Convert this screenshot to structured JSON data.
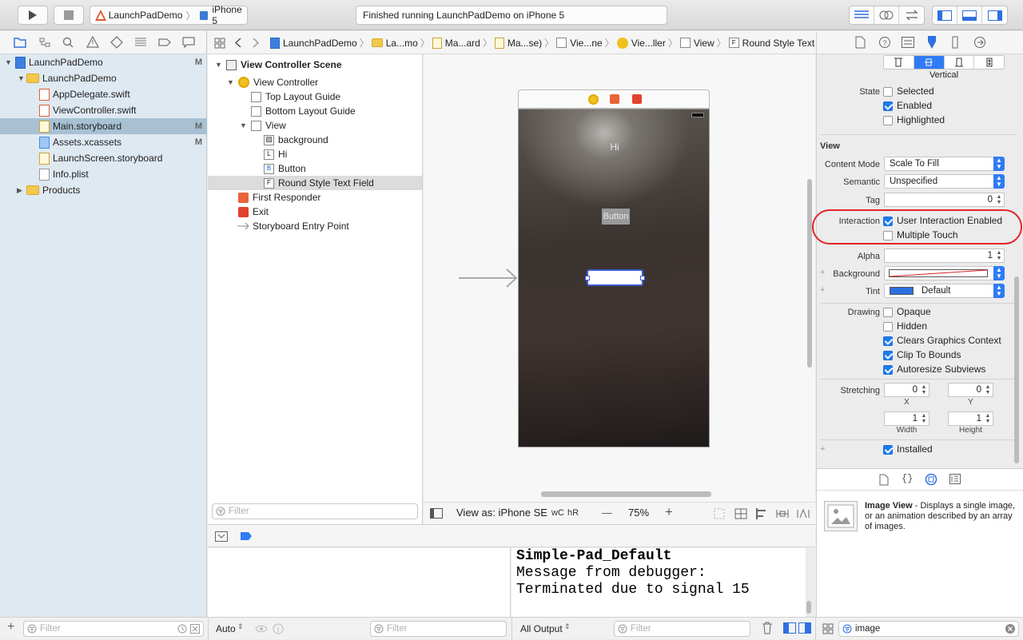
{
  "toolbar": {
    "scheme": "LaunchPadDemo",
    "device": "iPhone 5",
    "activity": "Finished running LaunchPadDemo on iPhone 5"
  },
  "navigator": {
    "items": [
      {
        "label": "LaunchPadDemo",
        "marker": "M"
      },
      {
        "label": "LaunchPadDemo",
        "marker": ""
      },
      {
        "label": "AppDelegate.swift",
        "marker": ""
      },
      {
        "label": "ViewController.swift",
        "marker": ""
      },
      {
        "label": "Main.storyboard",
        "marker": "M"
      },
      {
        "label": "Assets.xcassets",
        "marker": "M"
      },
      {
        "label": "LaunchScreen.storyboard",
        "marker": ""
      },
      {
        "label": "Info.plist",
        "marker": ""
      },
      {
        "label": "Products",
        "marker": ""
      }
    ],
    "filter_placeholder": "Filter"
  },
  "jumpbar": {
    "crumbs": [
      "LaunchPadDemo",
      "La...mo",
      "Ma...ard",
      "Ma...se)",
      "Vie...ne",
      "Vie...ller",
      "View",
      "Round Style Text Field"
    ]
  },
  "outline": {
    "items": [
      {
        "label": "View Controller Scene",
        "icon": "scene-icon"
      },
      {
        "label": "View Controller",
        "icon": "view-controller-icon"
      },
      {
        "label": "Top Layout Guide",
        "icon": "layout-guide-icon"
      },
      {
        "label": "Bottom Layout Guide",
        "icon": "layout-guide-icon"
      },
      {
        "label": "View",
        "icon": "view-icon"
      },
      {
        "label": "background",
        "icon": "image-view-icon"
      },
      {
        "label": "Hi",
        "icon": "label-icon",
        "glyph": "L"
      },
      {
        "label": "Button",
        "icon": "button-icon",
        "glyph": "B"
      },
      {
        "label": "Round Style Text Field",
        "icon": "text-field-icon",
        "glyph": "F"
      },
      {
        "label": "First Responder",
        "icon": "first-responder-icon"
      },
      {
        "label": "Exit",
        "icon": "exit-icon"
      },
      {
        "label": "Storyboard Entry Point",
        "icon": "entry-arrow-icon"
      }
    ],
    "filter_placeholder": "Filter"
  },
  "canvas": {
    "hi_label": "Hi",
    "button_label": "Button",
    "view_as": "View as: iPhone SE",
    "size_class_w": "wC",
    "size_class_h": "hR",
    "zoom_minus": "—",
    "zoom": "75%",
    "zoom_plus": "+"
  },
  "inspector": {
    "control_label": "Vertical",
    "state_label": "State",
    "state": [
      {
        "label": "Selected",
        "checked": false
      },
      {
        "label": "Enabled",
        "checked": true
      },
      {
        "label": "Highlighted",
        "checked": false
      }
    ],
    "view_section": "View",
    "content_mode_label": "Content Mode",
    "content_mode": "Scale To Fill",
    "semantic_label": "Semantic",
    "semantic": "Unspecified",
    "tag_label": "Tag",
    "tag": "0",
    "interaction_label": "Interaction",
    "interaction": [
      {
        "label": "User Interaction Enabled",
        "checked": true
      },
      {
        "label": "Multiple Touch",
        "checked": false
      }
    ],
    "alpha_label": "Alpha",
    "alpha": "1",
    "background_label": "Background",
    "tint_label": "Tint",
    "tint": "Default",
    "tint_color": "#2c6fe0",
    "drawing_label": "Drawing",
    "drawing": [
      {
        "label": "Opaque",
        "checked": false
      },
      {
        "label": "Hidden",
        "checked": false
      },
      {
        "label": "Clears Graphics Context",
        "checked": true
      },
      {
        "label": "Clip To Bounds",
        "checked": true
      },
      {
        "label": "Autoresize Subviews",
        "checked": true
      }
    ],
    "stretching_label": "Stretching",
    "stretch_x": "0",
    "stretch_y": "0",
    "stretch_w": "1",
    "stretch_h": "1",
    "x_label": "X",
    "y_label": "Y",
    "width_label": "Width",
    "height_label": "Height",
    "installed_label": "Installed",
    "installed": true
  },
  "library": {
    "item_title": "Image View",
    "item_desc": " - Displays a single image, or an animation described by an array of images.",
    "search_value": "image"
  },
  "debug": {
    "vars_mode": "Auto",
    "vars_filter": "Filter",
    "output_mode": "All Output",
    "console_filter": "Filter",
    "console_lines": [
      "Simple-Pad_Default",
      "Message from debugger:",
      "Terminated due to signal 15"
    ]
  },
  "colors": {
    "accent": "#1d7bf0",
    "highlight_ring": "#e0262a",
    "selection": "#a7c1d3"
  }
}
